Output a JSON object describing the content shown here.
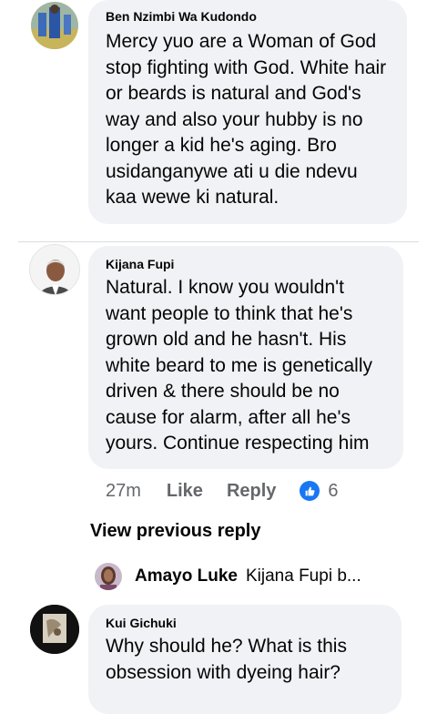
{
  "comments": [
    {
      "author": "Ben Nzimbi Wa Kudondo",
      "text": "Mercy yuo are a Woman of God stop fighting with God. White hair or beards is natural and God's way and also your hubby is no longer a kid he's aging. Bro usidanganywe ati u die ndevu kaa wewe ki natural."
    },
    {
      "author": "Kijana Fupi",
      "text": "Natural. I know you wouldn't want people to think that he's grown old and he hasn't. His white beard to me is genetically driven & there should be no cause for alarm, after all  he's yours. Continue respecting him",
      "time": "27m",
      "like_label": "Like",
      "reply_label": "Reply",
      "reaction_icon": "like-icon",
      "reaction_count": "6",
      "view_previous_label": "View previous reply",
      "reply_preview": {
        "author": "Amayo Luke",
        "snippet": "Kijana Fupi b..."
      }
    },
    {
      "author": "Kui Gichuki",
      "text": "Why should he? What is this obsession with dyeing hair?"
    }
  ],
  "colors": {
    "bubble": "#f0f2f5",
    "meta_text": "#65676b",
    "like_blue": "#1877f2"
  }
}
